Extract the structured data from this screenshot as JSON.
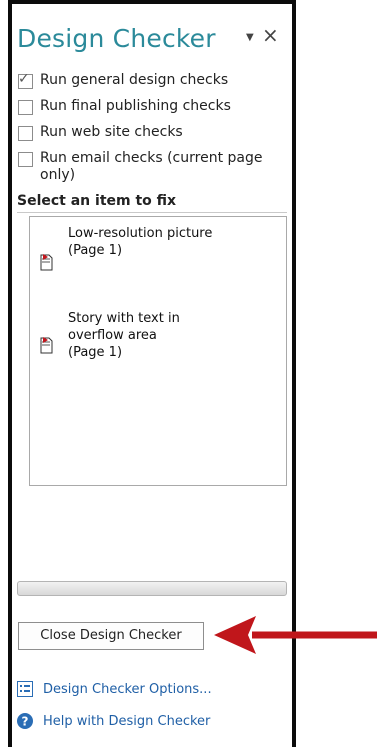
{
  "pane": {
    "title": "Design Checker",
    "menu_icon": "dropdown-triangle-icon",
    "close_icon": "close-x-icon"
  },
  "options": [
    {
      "label": "Run general design checks",
      "checked": true
    },
    {
      "label": "Run final publishing checks",
      "checked": false
    },
    {
      "label": "Run web site checks",
      "checked": false
    },
    {
      "label": "Run email checks (current page only)",
      "label_line1": "Run email checks (current page",
      "label_line2": "only)",
      "checked": false
    }
  ],
  "issues_section": {
    "header": "Select an item to fix",
    "items": [
      {
        "line1": "Low-resolution picture",
        "line2": "(Page 1)",
        "icon": "document-flag-icon"
      },
      {
        "line1": "Story with text in",
        "line2": "overflow area",
        "line3": "(Page 1)",
        "icon": "document-flag-icon"
      }
    ]
  },
  "buttons": {
    "close_label": "Close Design Checker"
  },
  "links": {
    "options_label": "Design Checker Options...",
    "help_label": "Help with Design Checker"
  },
  "colors": {
    "title": "#2b8a9a",
    "link": "#1f5fa6",
    "arrow": "#c0161b"
  }
}
